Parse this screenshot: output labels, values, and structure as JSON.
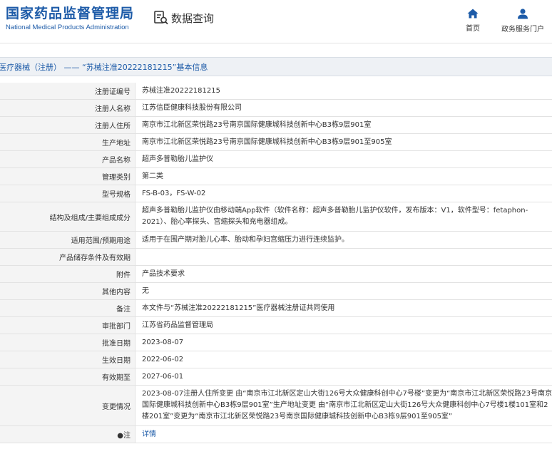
{
  "header": {
    "logo_cn": "国家药品监督管理局",
    "logo_en": "National Medical Products Administration",
    "query_label": "数据查询",
    "nav": [
      {
        "label": "首页",
        "icon": "home-icon"
      },
      {
        "label": "政务服务门户",
        "icon": "user-icon"
      }
    ]
  },
  "title": "医疗器械（注册） —— “苏械注准20222181215”基本信息",
  "rows": [
    {
      "label": "注册证编号",
      "value": "苏械注准20222181215"
    },
    {
      "label": "注册人名称",
      "value": "江苏信臣健康科技股份有限公司"
    },
    {
      "label": "注册人住所",
      "value": "南京市江北新区荣悦路23号南京国际健康城科技创新中心B3栋9层901室"
    },
    {
      "label": "生产地址",
      "value": "南京市江北新区荣悦路23号南京国际健康城科技创新中心B3栋9层901至905室"
    },
    {
      "label": "产品名称",
      "value": "超声多普勒胎儿监护仪"
    },
    {
      "label": "管理类别",
      "value": "第二类"
    },
    {
      "label": "型号规格",
      "value": "FS-B-03，FS-W-02"
    },
    {
      "label": "结构及组成/主要组成成分",
      "value": "超声多普勒胎儿监护仪由移动端App软件（软件名称：超声多普勒胎儿监护仪软件，发布版本：V1，软件型号：fetaphon-2021）、胎心率探头、宫缩探头和充电器组成。"
    },
    {
      "label": "适用范围/预期用途",
      "value": "适用于在围产期对胎儿心率、胎动和孕妇宫缩压力进行连续监护。"
    },
    {
      "label": "产品储存条件及有效期",
      "value": ""
    },
    {
      "label": "附件",
      "value": "产品技术要求"
    },
    {
      "label": "其他内容",
      "value": "无"
    },
    {
      "label": "备注",
      "value": "本文件与“苏械注准20222181215”医疗器械注册证共同使用"
    },
    {
      "label": "审批部门",
      "value": "江苏省药品监督管理局"
    },
    {
      "label": "批准日期",
      "value": "2023-08-07"
    },
    {
      "label": "生效日期",
      "value": "2022-06-02"
    },
    {
      "label": "有效期至",
      "value": "2027-06-01"
    },
    {
      "label": "变更情况",
      "value": "2023-08-07注册人住所变更 由“南京市江北新区定山大街126号大众健康科创中心7号楼”变更为“南京市江北新区荣悦路23号南京国际健康城科技创新中心B3栋9层901室”生产地址变更 由“南京市江北新区定山大街126号大众健康科创中心7号楼1楼101室和2楼201室”变更为“南京市江北新区荣悦路23号南京国际健康城科技创新中心B3栋9层901至905室”"
    }
  ],
  "note": {
    "label": "注",
    "link": "详情"
  }
}
